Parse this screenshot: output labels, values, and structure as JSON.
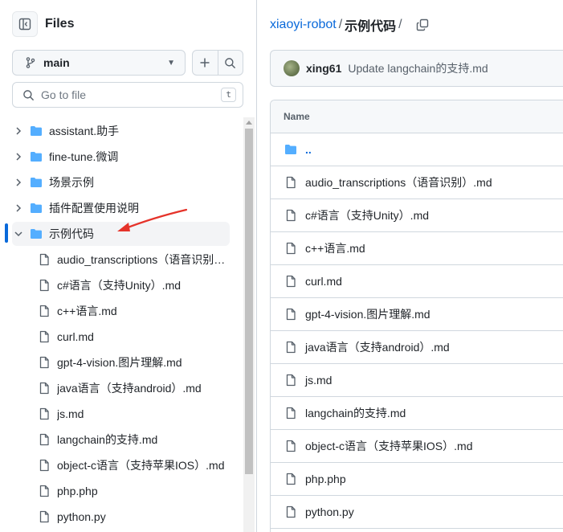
{
  "sidebar": {
    "title": "Files",
    "branch": "main",
    "goto": {
      "placeholder": "Go to file",
      "shortcut": "t"
    },
    "tree": [
      {
        "name": "assistant.助手",
        "type": "dir",
        "expanded": false
      },
      {
        "name": "fine-tune.微调",
        "type": "dir",
        "expanded": false
      },
      {
        "name": "场景示例",
        "type": "dir",
        "expanded": false
      },
      {
        "name": "插件配置使用说明",
        "type": "dir",
        "expanded": false
      },
      {
        "name": "示例代码",
        "type": "dir",
        "expanded": true,
        "active": true
      },
      {
        "name": "audio_transcriptions（语音识别）.md",
        "type": "file"
      },
      {
        "name": "c#语言（支持Unity）.md",
        "type": "file"
      },
      {
        "name": "c++语言.md",
        "type": "file"
      },
      {
        "name": "curl.md",
        "type": "file"
      },
      {
        "name": "gpt-4-vision.图片理解.md",
        "type": "file"
      },
      {
        "name": "java语言（支持android）.md",
        "type": "file"
      },
      {
        "name": "js.md",
        "type": "file"
      },
      {
        "name": "langchain的支持.md",
        "type": "file"
      },
      {
        "name": "object-c语言（支持苹果IOS）.md",
        "type": "file"
      },
      {
        "name": "php.php",
        "type": "file"
      },
      {
        "name": "python.py",
        "type": "file"
      }
    ]
  },
  "breadcrumb": {
    "repo": "xiaoyi-robot",
    "sep1": "/",
    "current": "示例代码",
    "sep2": "/"
  },
  "commit": {
    "author": "xing61",
    "message": "Update langchain的支持.md"
  },
  "table": {
    "header": "Name",
    "rows": [
      {
        "name": "..",
        "type": "dir"
      },
      {
        "name": "audio_transcriptions（语音识别）.md",
        "type": "file"
      },
      {
        "name": "c#语言（支持Unity）.md",
        "type": "file"
      },
      {
        "name": "c++语言.md",
        "type": "file"
      },
      {
        "name": "curl.md",
        "type": "file"
      },
      {
        "name": "gpt-4-vision.图片理解.md",
        "type": "file"
      },
      {
        "name": "java语言（支持android）.md",
        "type": "file"
      },
      {
        "name": "js.md",
        "type": "file"
      },
      {
        "name": "langchain的支持.md",
        "type": "file"
      },
      {
        "name": "object-c语言（支持苹果IOS）.md",
        "type": "file"
      },
      {
        "name": "php.php",
        "type": "file"
      },
      {
        "name": "python.py",
        "type": "file"
      }
    ]
  },
  "colors": {
    "accent": "#0969da",
    "folder": "#54aeff",
    "annotation_arrow": "#e5332a"
  }
}
